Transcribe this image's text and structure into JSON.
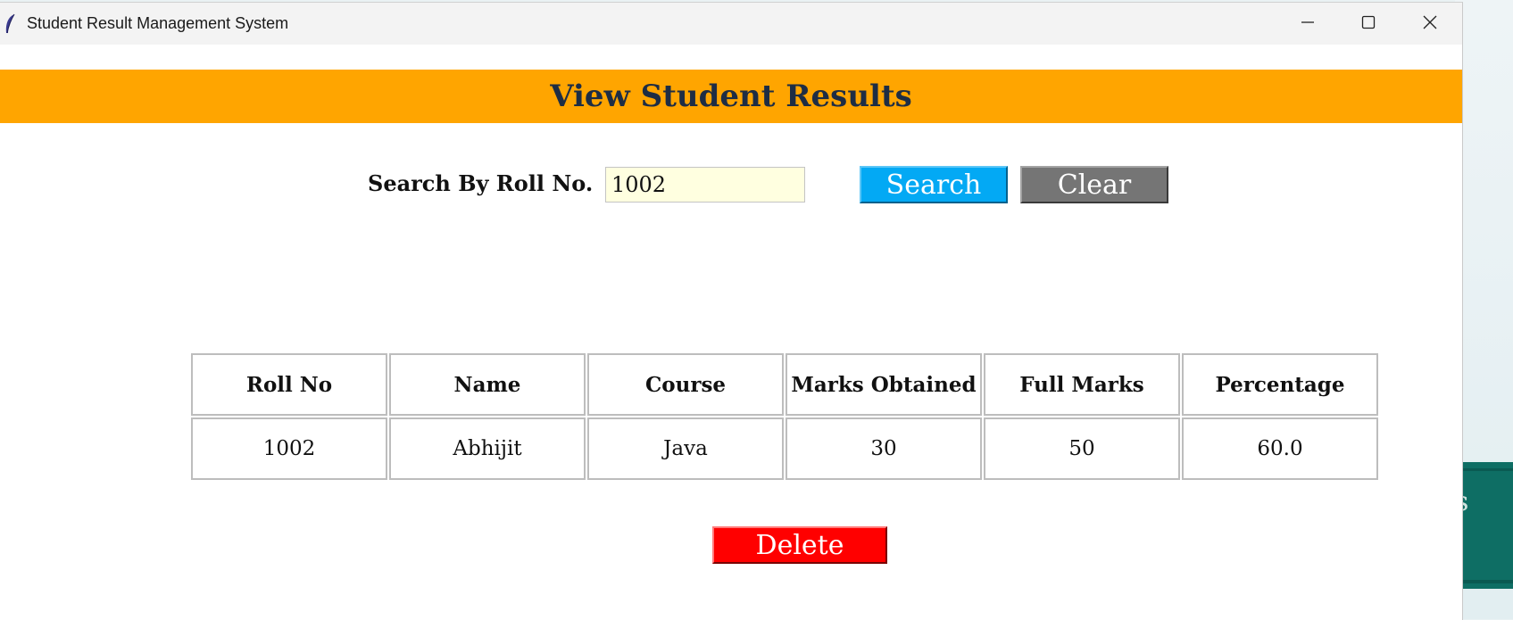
{
  "window": {
    "title": "Student Result Management System",
    "controls": {
      "minimize": "minimize-icon",
      "maximize": "maximize-icon",
      "close": "close-icon"
    }
  },
  "banner": {
    "title": "View Student Results",
    "color": "#ffa500"
  },
  "search": {
    "label": "Search By Roll No.",
    "value": "1002",
    "search_label": "Search",
    "clear_label": "Clear"
  },
  "table": {
    "headers": [
      "Roll No",
      "Name",
      "Course",
      "Marks Obtained",
      "Full Marks",
      "Percentage"
    ],
    "rows": [
      [
        "1002",
        "Abhijit",
        "Java",
        "30",
        "50",
        "60.0"
      ]
    ]
  },
  "actions": {
    "delete_label": "Delete"
  },
  "background_app": {
    "visible_text": "ts"
  },
  "colors": {
    "search": "#03a9f4",
    "clear": "#757575",
    "delete": "#ff0000",
    "input_bg": "#ffffe0"
  }
}
